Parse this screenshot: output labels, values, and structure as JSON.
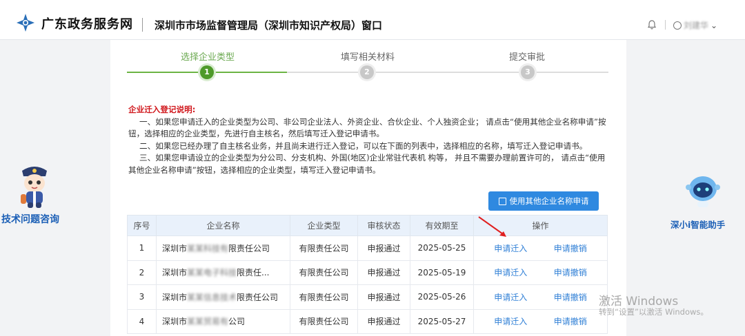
{
  "header": {
    "brand": "广东政务服务网",
    "department": "深圳市市场监督管理局（深圳市知识产权局）窗口",
    "user_name": "刘建华"
  },
  "steps": [
    {
      "label": "选择企业类型",
      "number": "1",
      "state": "active"
    },
    {
      "label": "填写相关材料",
      "number": "2",
      "state": "pending"
    },
    {
      "label": "提交审批",
      "number": "3",
      "state": "pending"
    }
  ],
  "notes": {
    "title": "企业迁入登记说明:",
    "lines": [
      "一、如果您申请迁入的企业类型为公司、非公司企业法人、外资企业、合伙企业、个人独资企业；  请点击“使用其他企业名称申请”按",
      "钮，选择相应的企业类型，先进行自主核名，然后填写迁入登记申请书。",
      "二、如果您已经办理了自主核名业务，并且尚未进行迁入登记，可以在下面的列表中，选择相应的名称，填写迁入登记申请书。",
      "三、如果您申请设立的企业类型为分公司、分支机构、外国(地区)企业常驻代表机 构等，  并且不需要办理前置许可的，  请点击“使用",
      "其他企业名称申请”按钮，选择相应的企业类型，填写迁入登记申请书。"
    ]
  },
  "other_button": "使用其他企业名称申请",
  "table": {
    "headers": [
      "序号",
      "企业名称",
      "企业类型",
      "审核状态",
      "有效期至",
      "操作"
    ],
    "rows": [
      {
        "no": "1",
        "name_prefix": "深圳市",
        "name_hidden": "某某科技有",
        "name_suffix": "限责任公司",
        "type": "有限责任公司",
        "status": "申报通过",
        "expiry": "2025-05-25"
      },
      {
        "no": "2",
        "name_prefix": "深圳市",
        "name_hidden": "某某电子科技",
        "name_suffix": "限责任...",
        "type": "有限责任公司",
        "status": "申报通过",
        "expiry": "2025-05-19"
      },
      {
        "no": "3",
        "name_prefix": "深圳市",
        "name_hidden": "某某信息技术",
        "name_suffix": "限责任公司",
        "type": "有限责任公司",
        "status": "申报通过",
        "expiry": "2025-05-26"
      },
      {
        "no": "4",
        "name_prefix": "深圳市",
        "name_hidden": "某某贸易有",
        "name_suffix": "公司",
        "type": "有限责任公司",
        "status": "申报通过",
        "expiry": "2025-05-27"
      }
    ],
    "action_move_in": "申请迁入",
    "action_cancel": "申请撤销"
  },
  "support": {
    "left_label": "技术问题咨询",
    "right_label": "深小i智能助手"
  },
  "watermark": {
    "line1": "激活 Windows",
    "line2": "转到“设置”以激活 Windows。"
  },
  "colors": {
    "brand_blue": "#1b5fb6",
    "step_green": "#4e9a2a",
    "note_red": "#d0161b",
    "button_blue": "#2f89e0",
    "link_blue": "#2f7fd6"
  }
}
